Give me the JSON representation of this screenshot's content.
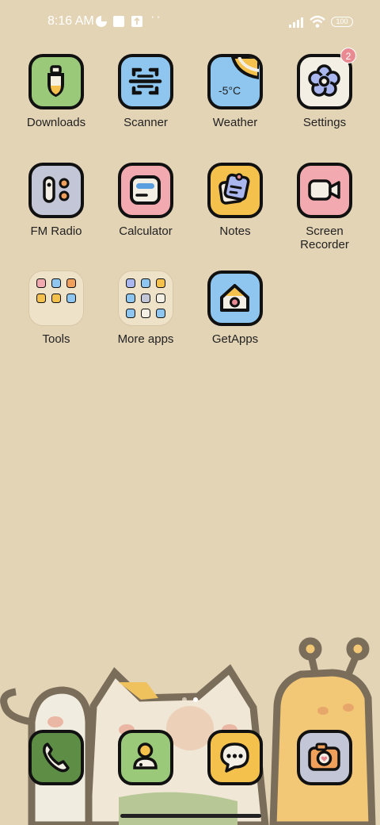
{
  "status_bar": {
    "time": "8:16 AM",
    "notification_icons": [
      "pinwheel-icon",
      "square-icon",
      "upload-box-icon"
    ],
    "more": "··",
    "battery": "100"
  },
  "apps": [
    {
      "label": "Downloads"
    },
    {
      "label": "Scanner"
    },
    {
      "label": "Weather",
      "temp": "-5°C"
    },
    {
      "label": "Settings",
      "badge": "2"
    },
    {
      "label": "FM Radio"
    },
    {
      "label": "Calculator"
    },
    {
      "label": "Notes"
    },
    {
      "label": "Screen Recorder"
    },
    {
      "label": "Tools"
    },
    {
      "label": "More apps"
    },
    {
      "label": "GetApps"
    }
  ],
  "dock": [
    "phone-icon",
    "contacts-icon",
    "messages-icon",
    "camera-icon"
  ],
  "page_indicator": {
    "pages": 2,
    "current": 2
  },
  "colors": {
    "wallpaper": "#e4d4b6",
    "green": "#9bc97a",
    "blue": "#8ec6ef",
    "yellow": "#f5c14d",
    "pink": "#f2aab0",
    "grey_blue": "#c3c6d7",
    "cream": "#f3efe4",
    "dark_green": "#5e8e45"
  }
}
